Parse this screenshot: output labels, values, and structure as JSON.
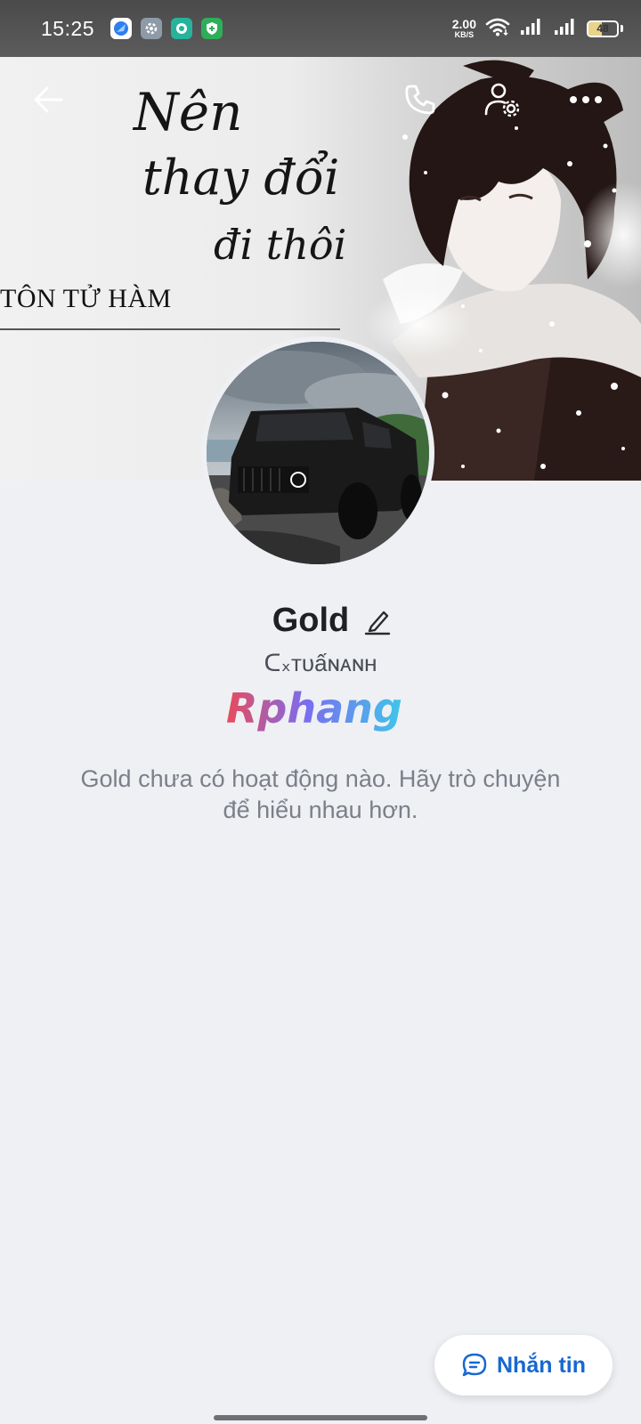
{
  "status_bar": {
    "time": "15:25",
    "net_speed_value": "2.00",
    "net_speed_unit": "KB/S",
    "battery_level": "48",
    "icons": [
      "browser-app-icon",
      "settings-app-icon",
      "chat-app-icon",
      "security-app-icon",
      "wifi-icon",
      "signal-icon",
      "signal-icon",
      "battery-icon"
    ]
  },
  "header": {
    "back_icon": "arrow-left-icon",
    "call_icon": "phone-icon",
    "settings_icon": "user-settings-icon",
    "more_icon": "more-horizontal-icon"
  },
  "cover": {
    "script_line1": "Nên",
    "script_line2": "thay đổi",
    "script_line3": "đi thôi",
    "author": "TÔN TỬ HÀM"
  },
  "profile": {
    "name": "Gold",
    "nickname": "ᑕ᙮ᴛᴜấɴᴀɴʜ",
    "empty_message": "Gold chưa có hoạt động nào. Hãy trò chuyện để hiểu nhau hơn.",
    "watermark": "Rphang"
  },
  "actions": {
    "message_label": "Nhắn tin",
    "message_icon": "chat-bubble-icon"
  },
  "colors": {
    "accent": "#1768d1",
    "background": "#eef0f4",
    "status_bar": "#555555"
  }
}
